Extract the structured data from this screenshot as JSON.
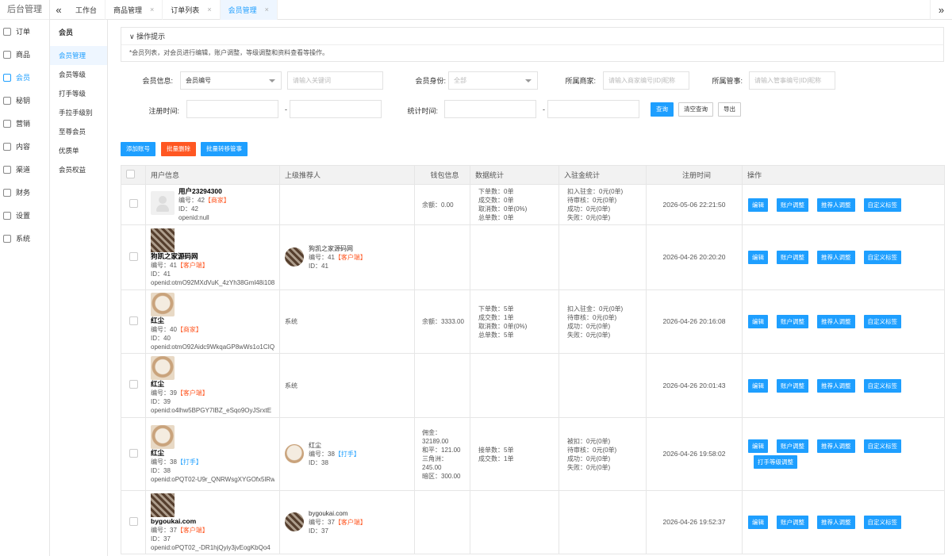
{
  "brand": "后台管理",
  "left_nav": [
    {
      "label": "订单",
      "icon": "bell-icon"
    },
    {
      "label": "商品",
      "icon": "cart-icon"
    },
    {
      "label": "会员",
      "icon": "user-icon"
    },
    {
      "label": "秘钥",
      "icon": "key-icon"
    },
    {
      "label": "营销",
      "icon": "megaphone-icon"
    },
    {
      "label": "内容",
      "icon": "content-icon"
    },
    {
      "label": "渠道",
      "icon": "phone-icon"
    },
    {
      "label": "财务",
      "icon": "money-icon"
    },
    {
      "label": "设置",
      "icon": "gear-icon"
    },
    {
      "label": "系统",
      "icon": "system-icon"
    }
  ],
  "tabs": [
    {
      "label": "工作台"
    },
    {
      "label": "商品管理"
    },
    {
      "label": "订单列表"
    },
    {
      "label": "会员管理"
    }
  ],
  "sub_nav": {
    "title": "会员",
    "items": [
      "会员管理",
      "会员等级",
      "打手等级",
      "手拉手级别",
      "至尊会员",
      "优质单",
      "会员权益"
    ]
  },
  "tips": {
    "title": "操作提示",
    "text": "*会员列表，对会员进行编辑，账户调整，等级调整和资料查看等操作。"
  },
  "filters": {
    "member_info_label": "会员信息:",
    "member_info_select": "会员编号",
    "keyword_placeholder": "请输入关键词",
    "identity_label": "会员身份:",
    "identity_value": "全部",
    "merchant_label": "所属商家:",
    "merchant_placeholder": "请输入商家编号|ID|昵称",
    "manager_label": "所属管事:",
    "manager_placeholder": "请输入管事编号|ID|昵称",
    "reg_time_label": "注册时间:",
    "stat_time_label": "统计时间:",
    "dash": "-",
    "search_btn": "查询",
    "clear_btn": "清空查询",
    "export_btn": "导出"
  },
  "actions": {
    "add": "添加账号",
    "batch_delete": "批量删除",
    "batch_transfer": "批量转移管事"
  },
  "table": {
    "headers": [
      "用户信息",
      "上级推荐人",
      "钱包信息",
      "数据统计",
      "入驻金统计",
      "注册时间",
      "操作"
    ],
    "op_labels": {
      "edit": "编辑",
      "account": "账户调整",
      "referrer": "推荐人调整",
      "tag": "自定义标签",
      "level": "打手等级调整"
    },
    "rows": [
      {
        "name": "用户23294300",
        "no": "编号：42",
        "role": "【商家】",
        "role_color": "red",
        "id": "ID：42",
        "openid": "openid:null",
        "ref": null,
        "ref_text": "",
        "wallet": [
          "余额：0.00"
        ],
        "stats": [
          "下单数：0单",
          "成交数：0单",
          "取消数：0单(0%)",
          "总单数：0单"
        ],
        "fund": [
          "扣入驻金：0元(0单)",
          "待审核：0元(0单)",
          "成功：0元(0单)",
          "失败：0元(0单)"
        ],
        "time": "2026-05-06 22:21:50",
        "avatar": "default",
        "level_btn": false
      },
      {
        "name": "狗凯之家源码网",
        "no": "编号：41",
        "role": "【客户端】",
        "role_color": "red",
        "id": "ID：41",
        "openid": "openid:otmO92MXdVuK_4zYh38Gml48i108",
        "ref": {
          "name": "狗凯之家源码网",
          "no": "编号：41",
          "role": "【客户端】",
          "role_color": "red",
          "id": "ID：41"
        },
        "ref_text": "",
        "wallet": [],
        "stats": [],
        "fund": [],
        "time": "2026-04-26 20:20:20",
        "avatar": "qr",
        "level_btn": false
      },
      {
        "name": "红尘",
        "no": "编号：40",
        "role": "【商家】",
        "role_color": "red",
        "id": "ID：40",
        "openid": "openid:otmO92Aidc9WkqaGP8wWs1o1CIQw",
        "ref": null,
        "ref_text": "系统",
        "wallet": [
          "余额：3333.00"
        ],
        "stats": [
          "下单数：5单",
          "成交数：1单",
          "取消数：0单(0%)",
          "总单数：5单"
        ],
        "fund": [
          "扣入驻金：0元(0单)",
          "待审核：0元(0单)",
          "成功：0元(0单)",
          "失败：0元(0单)"
        ],
        "time": "2026-04-26 20:16:08",
        "avatar": "dog",
        "level_btn": false
      },
      {
        "name": "红尘",
        "no": "编号：39",
        "role": "【客户端】",
        "role_color": "red",
        "id": "ID：39",
        "openid": "openid:o4lhw5BPGY7IBZ_eSqo9OyJSrxtE",
        "ref": null,
        "ref_text": "系统",
        "wallet": [],
        "stats": [],
        "fund": [],
        "time": "2026-04-26 20:01:43",
        "avatar": "dog",
        "level_btn": false
      },
      {
        "name": "红尘",
        "no": "编号：38",
        "role": "【打手】",
        "role_color": "blue",
        "id": "ID：38",
        "openid": "openid:oPQT02-U9r_QNRWsgXYGOfx5lRw",
        "ref": {
          "name": "红尘",
          "no": "编号：38",
          "role": "【打手】",
          "role_color": "blue",
          "id": "ID：38"
        },
        "ref_text": "",
        "wallet": [
          "佣金：32189.00",
          "和平：121.00",
          "三角洲：245.00",
          "暗区：300.00"
        ],
        "stats": [
          "接单数：5单",
          "成交数：1单"
        ],
        "fund": [
          "被扣：0元(0单)",
          "待审核：0元(0单)",
          "成功：0元(0单)",
          "失败：0元(0单)"
        ],
        "time": "2026-04-26 19:58:02",
        "avatar": "dog",
        "level_btn": true
      },
      {
        "name": "bygoukai.com",
        "no": "编号：37",
        "role": "【客户端】",
        "role_color": "red",
        "id": "ID：37",
        "openid": "openid:oPQT02_-DR1hjQyiy3jvEogKbQo4",
        "ref": {
          "name": "bygoukai.com",
          "no": "编号：37",
          "role": "【客户端】",
          "role_color": "red",
          "id": "ID：37"
        },
        "ref_text": "",
        "wallet": [],
        "stats": [],
        "fund": [],
        "time": "2026-04-26 19:52:37",
        "avatar": "qr",
        "level_btn": false
      }
    ]
  }
}
